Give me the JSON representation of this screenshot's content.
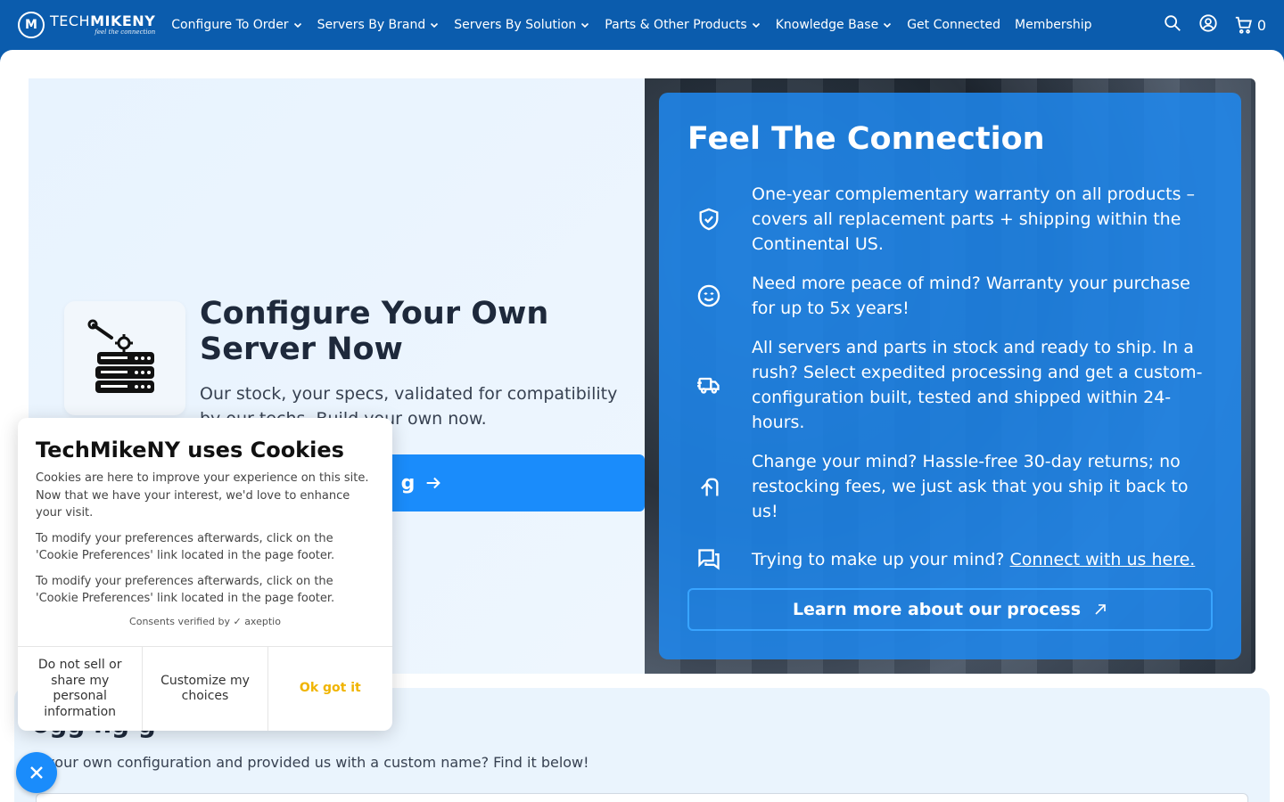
{
  "nav": {
    "logo_word_light": "TECH",
    "logo_word_bold": "MIKENY",
    "logo_tagline": "feel the connection",
    "items": [
      {
        "label": "Configure To Order",
        "dropdown": true
      },
      {
        "label": "Servers By Brand",
        "dropdown": true
      },
      {
        "label": "Servers By Solution",
        "dropdown": true
      },
      {
        "label": "Parts & Other Products",
        "dropdown": true
      },
      {
        "label": "Knowledge Base",
        "dropdown": true
      },
      {
        "label": "Get Connected",
        "dropdown": false
      },
      {
        "label": "Membership",
        "dropdown": false
      }
    ],
    "cart_count": "0"
  },
  "hero": {
    "title": "Configure Your Own Server Now",
    "subtitle": "Our stock, your specs, validated for compatibility by our techs. Build your own now.",
    "build_button_label": "g"
  },
  "connection": {
    "title": "Feel The Connection",
    "features": [
      {
        "icon": "shield-check-icon",
        "text": "One-year complementary warranty on all products – covers all replacement parts + shipping within the Continental US."
      },
      {
        "icon": "smile-icon",
        "text": "Need more peace of mind? Warranty your purchase for up to 5x years!"
      },
      {
        "icon": "truck-icon",
        "text": "All servers and parts in stock and ready to ship. In a rush? Select expedited processing and get a custom-configuration built, tested and shipped within 24-hours."
      },
      {
        "icon": "return-arrow-icon",
        "text": "Change your mind? Hassle-free 30-day returns; no restocking fees, we just ask that you ship it back to us!"
      },
      {
        "icon": "chat-icon",
        "text": "Trying to make up your mind? ",
        "link": "Connect with us here."
      }
    ],
    "learn_button": "Learn more about our process"
  },
  "bottom": {
    "title": "ogg ng g",
    "text": "lt your own configuration and provided us with a custom name? Find it below!"
  },
  "cookie": {
    "title": "TechMikeNY uses Cookies",
    "paragraphs": [
      "Cookies are here to improve your experience on this site. Now that we have your interest, we'd love to enhance your visit.",
      "To modify your preferences afterwards, click on the 'Cookie Preferences' link located in the page footer.",
      "To modify your preferences afterwards, click on the 'Cookie Preferences' link located in the page footer."
    ],
    "verified_text": "Consents verified by",
    "verified_brand": "axeptio",
    "buttons": {
      "dont_sell": "Do not sell or share my personal information",
      "customize": "Customize my choices",
      "ok": "Ok got it"
    }
  }
}
